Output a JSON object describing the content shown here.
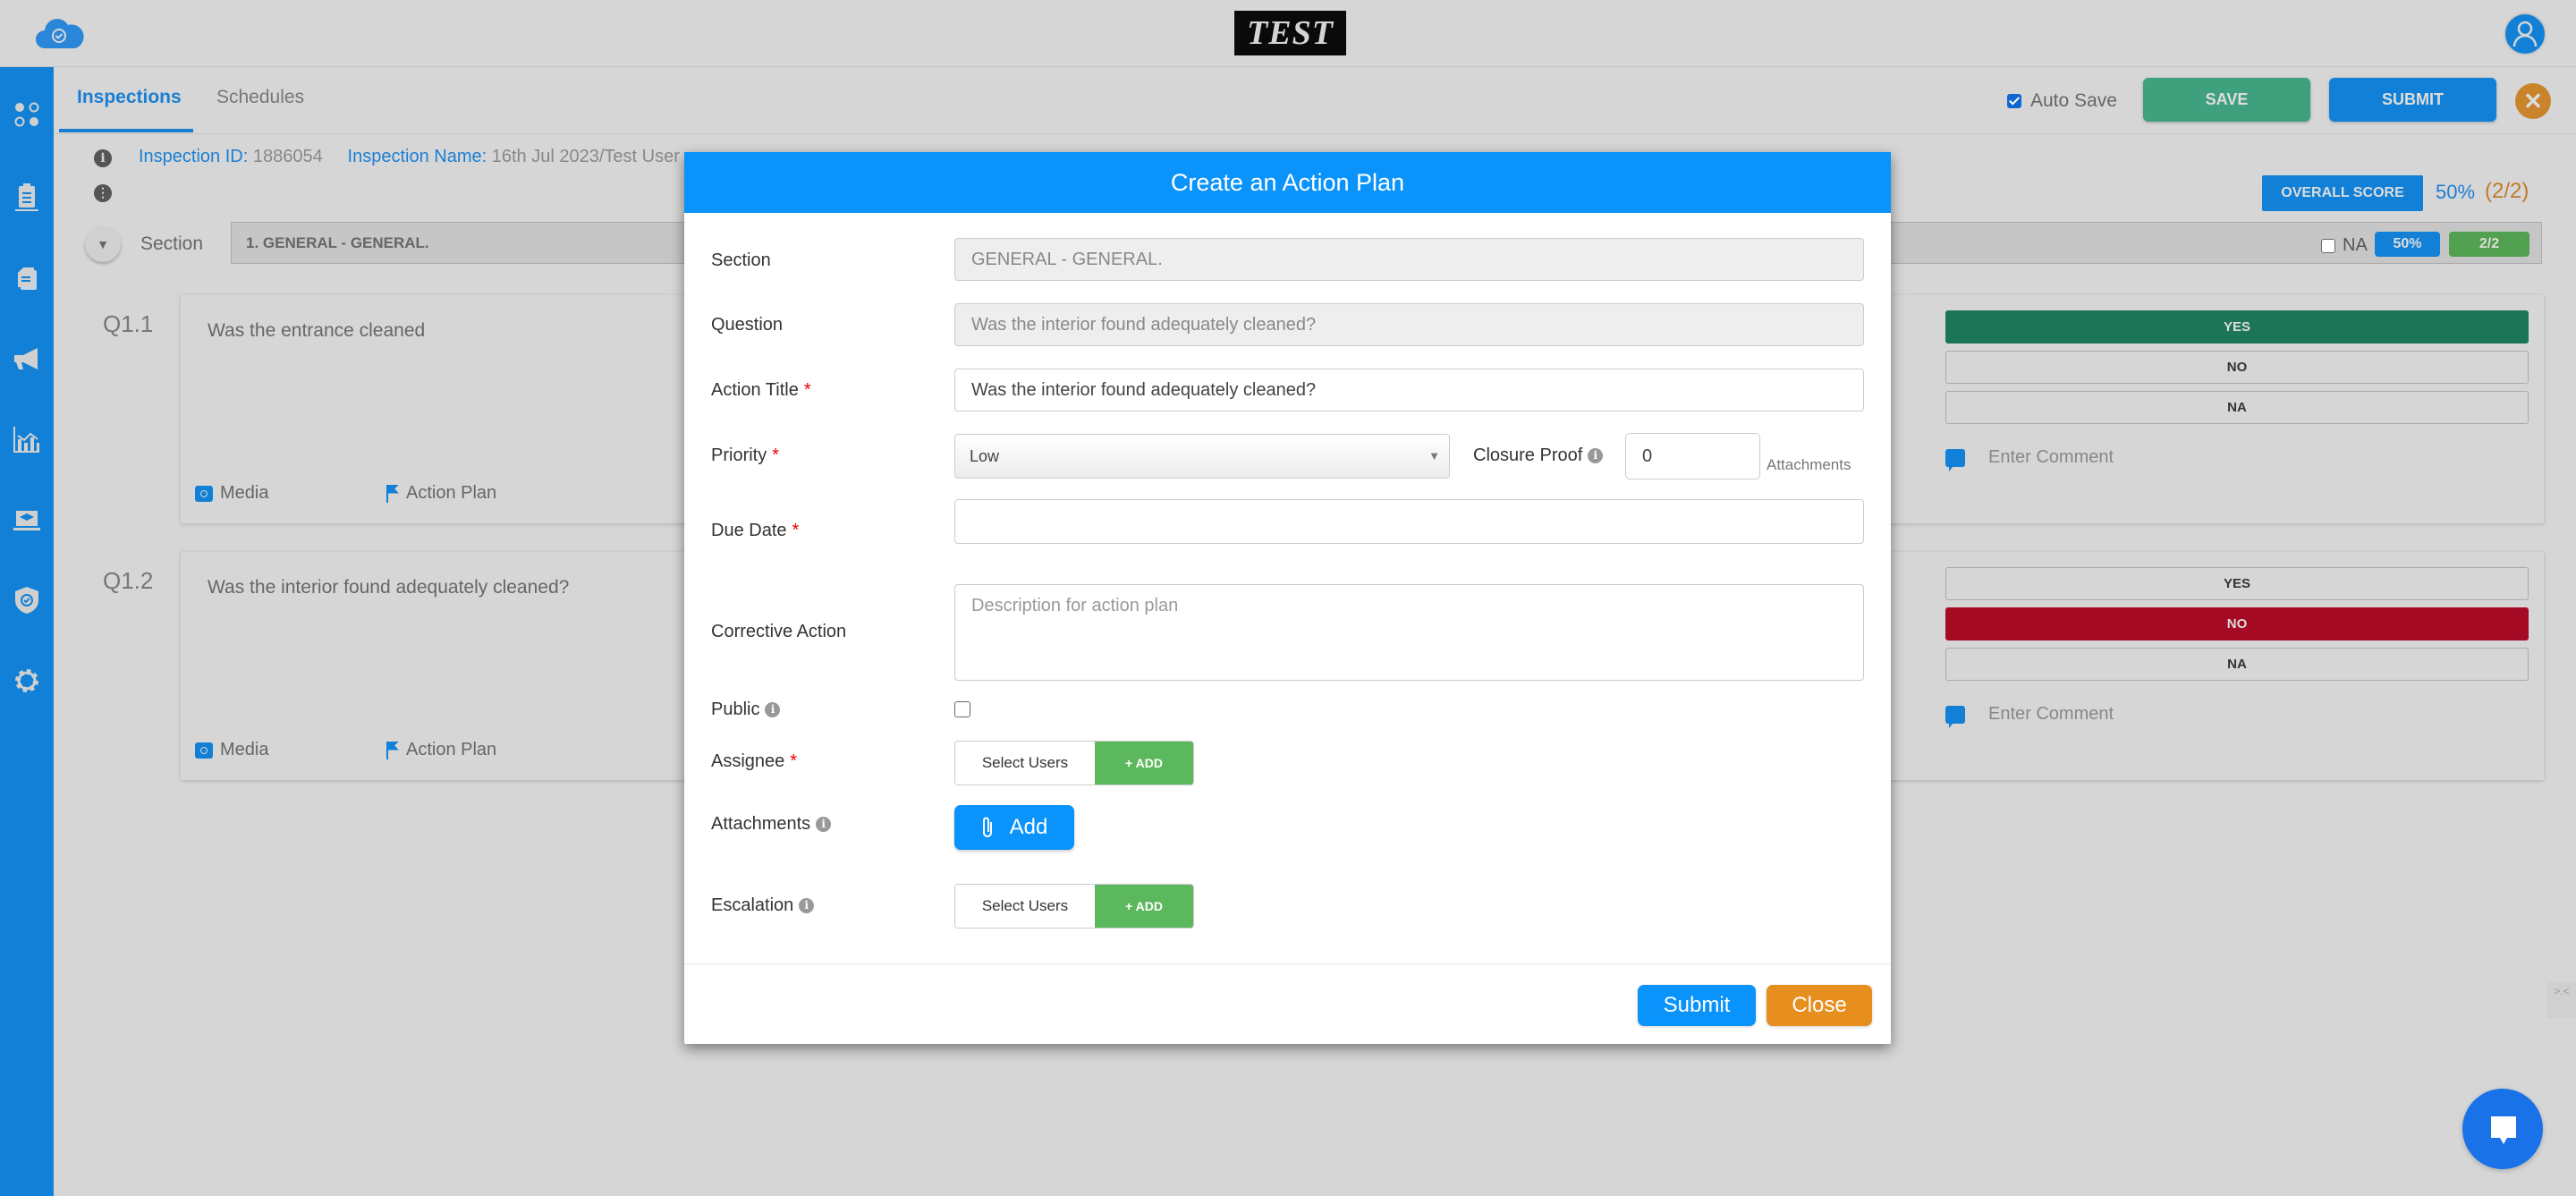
{
  "header": {
    "brand_logo_text": "TEST",
    "logo_icon": "cloud-check-icon",
    "avatar_icon": "user-icon"
  },
  "sidebar": {
    "items": [
      {
        "icon": "apps-dots-icon"
      },
      {
        "icon": "clipboard-icon"
      },
      {
        "icon": "documents-icon"
      },
      {
        "icon": "megaphone-icon"
      },
      {
        "icon": "analytics-chart-icon"
      },
      {
        "icon": "training-laptop-icon"
      },
      {
        "icon": "shield-check-icon"
      },
      {
        "icon": "settings-gear-icon"
      }
    ]
  },
  "tabs": [
    {
      "label": "Inspections",
      "active": true
    },
    {
      "label": "Schedules",
      "active": false
    }
  ],
  "toolbar": {
    "auto_save_label": "Auto Save",
    "auto_save_checked": true,
    "save_label": "SAVE",
    "submit_label": "SUBMIT",
    "close_label": "✕"
  },
  "inspection": {
    "id_label": "Inspection ID:",
    "id_value": "1886054",
    "name_label": "Inspection Name:",
    "name_value": "16th Jul 2023/Test User",
    "overall_score_label": "OVERALL SCORE",
    "overall_pct": "50%",
    "overall_frac": "(2/2)"
  },
  "section": {
    "label": "Section",
    "value": "1. GENERAL - GENERAL.",
    "na_label": "NA",
    "pct": "50%",
    "frac": "2/2"
  },
  "questions": [
    {
      "num": "Q1.1",
      "text": "Was the entrance cleaned",
      "media_label": "Media",
      "action_plan_label": "Action Plan",
      "answers": [
        "YES",
        "NO",
        "NA"
      ],
      "selected": "YES",
      "comment_placeholder": "Enter Comment"
    },
    {
      "num": "Q1.2",
      "text": "Was the interior found adequately cleaned?",
      "media_label": "Media",
      "action_plan_label": "Action Plan",
      "answers": [
        "YES",
        "NO",
        "NA"
      ],
      "selected": "NO",
      "comment_placeholder": "Enter Comment"
    }
  ],
  "modal": {
    "title": "Create an Action Plan",
    "section_label": "Section",
    "section_value": "GENERAL - GENERAL.",
    "question_label": "Question",
    "question_value": "Was the interior found adequately cleaned?",
    "action_title_label": "Action Title",
    "action_title_value": "Was the interior found adequately cleaned?",
    "priority_label": "Priority",
    "priority_value": "Low",
    "closure_proof_label": "Closure Proof",
    "closure_proof_value": "0",
    "closure_proof_suffix": "Attachments",
    "due_date_label": "Due Date",
    "due_date_value": "",
    "corrective_action_label": "Corrective Action",
    "corrective_action_placeholder": "Description for action plan",
    "public_label": "Public",
    "public_checked": false,
    "assignee_label": "Assignee",
    "assignee_select_label": "Select Users",
    "assignee_add_label": "+ ADD",
    "attachments_label": "Attachments",
    "attachments_add_label": "Add",
    "escalation_label": "Escalation",
    "escalation_select_label": "Select Users",
    "escalation_add_label": "+ ADD",
    "required_mark": "*",
    "submit_label": "Submit",
    "close_label": "Close"
  },
  "colors": {
    "primary": "#1180d6",
    "modal_header": "#0a93fa",
    "save_green": "#3fa07e",
    "yes_selected": "#1c7556",
    "no_selected": "#a50a24",
    "add_green": "#5cb85c",
    "close_orange": "#e68f1f"
  },
  "widgets": {
    "peek_text": ">.<"
  }
}
